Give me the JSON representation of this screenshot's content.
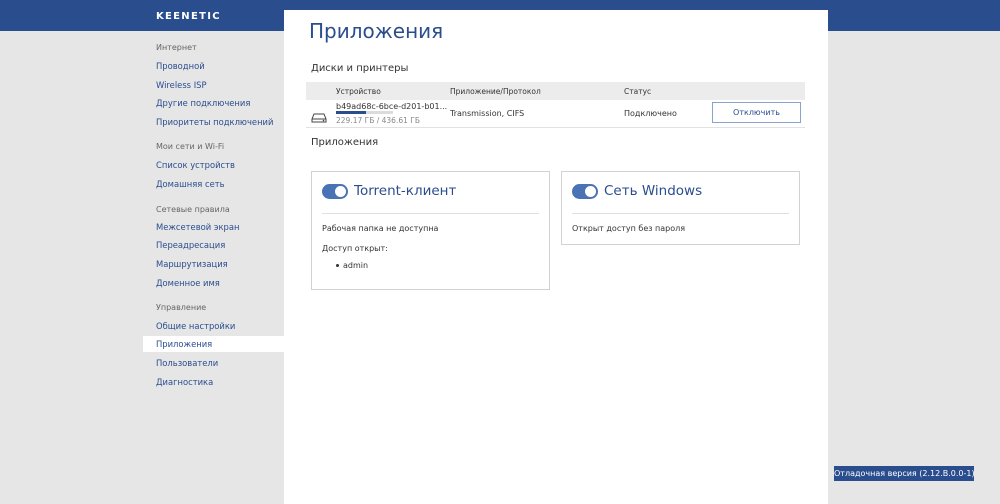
{
  "header": {
    "logo": "KEENETIC"
  },
  "sidebar": {
    "groups": [
      {
        "title": "Интернет",
        "items": [
          "Проводной",
          "Wireless ISP",
          "Другие подключения",
          "Приоритеты подключений"
        ]
      },
      {
        "title": "Мои сети и Wi-Fi",
        "items": [
          "Список устройств",
          "Домашняя сеть"
        ]
      },
      {
        "title": "Сетевые правила",
        "items": [
          "Межсетевой экран",
          "Переадресация",
          "Маршрутизация",
          "Доменное имя"
        ]
      },
      {
        "title": "Управление",
        "items": [
          "Общие настройки",
          "Приложения",
          "Пользователи",
          "Диагностика"
        ]
      }
    ]
  },
  "main": {
    "title": "Приложения",
    "disks_section": "Диски и принтеры",
    "table": {
      "headers": [
        "Устройство",
        "Приложение/Протокол",
        "Статус"
      ],
      "row": {
        "device": "b49ad68c-6bce-d201-b01...",
        "size": "229.17 ГБ / 436.61 ГБ",
        "usage_fraction": 0.525,
        "protocol": "Transmission, CIFS",
        "status": "Подключено",
        "action": "Отключить"
      }
    },
    "apps_section": "Приложения",
    "apps": [
      {
        "title": "Torrent-клиент",
        "enabled": true,
        "line1": "Рабочая папка не доступна",
        "line2": "Доступ открыт:",
        "users": [
          "admin"
        ]
      },
      {
        "title": "Сеть Windows",
        "enabled": true,
        "line1": "Открыт доступ без пароля"
      }
    ]
  },
  "footer": {
    "version": "Отладочная версия (2.12.B.0.0-1)"
  },
  "colors": {
    "brand": "#2a4d8e",
    "toggle": "#4a73b5",
    "background": "#e6e6e6"
  }
}
